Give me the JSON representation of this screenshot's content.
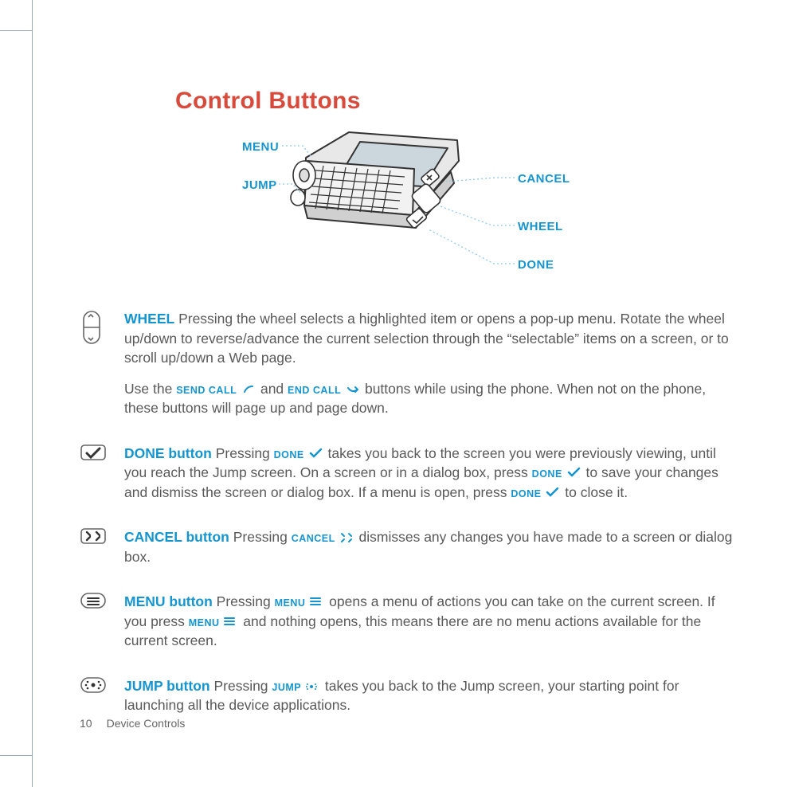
{
  "page": {
    "number": "10",
    "section": "Device Controls"
  },
  "heading": "Control Buttons",
  "diagram": {
    "labels": {
      "menu": "MENU",
      "jump": "JUMP",
      "cancel": "CANCEL",
      "wheel": "WHEEL",
      "done": "DONE"
    }
  },
  "sc": {
    "send": "SEND CALL",
    "end": "END CALL",
    "done": "DONE",
    "cancel": "CANCEL",
    "menu": "MENU",
    "jump": "JUMP"
  },
  "sec_wheel": {
    "title": "WHEEL",
    "p1_after": " Pressing the wheel selects a highlighted item or opens a pop-up menu. Rotate the wheel up/down to reverse/advance the current selection through the “selectable” items on a screen, or to scroll up/down a Web page.",
    "p2_a": "Use the ",
    "p2_b": " and ",
    "p2_c": " buttons while using the phone. When not on the phone, these buttons will page up and page down."
  },
  "sec_done": {
    "title": "DONE button",
    "a": "  Pressing ",
    "b": " takes you back to the screen you were previously viewing, until you reach the Jump screen. On a screen or in a dialog box, press ",
    "c": " to save your changes and dismiss the screen or dialog box. If a menu is open, press ",
    "d": " to close it."
  },
  "sec_cancel": {
    "title": "CANCEL button",
    "a": "  Pressing ",
    "b": " dismisses any changes you have made to a screen or dialog box."
  },
  "sec_menu": {
    "title": "MENU button",
    "a": "  Pressing ",
    "b": "  opens a menu of actions you can take on the current screen. If you press ",
    "c": " and nothing opens, this means there are no menu actions available for the current screen."
  },
  "sec_jump": {
    "title": "JUMP button",
    "a": "  Pressing ",
    "b": " takes you back to the Jump screen, your starting point for launching all the device applications."
  }
}
